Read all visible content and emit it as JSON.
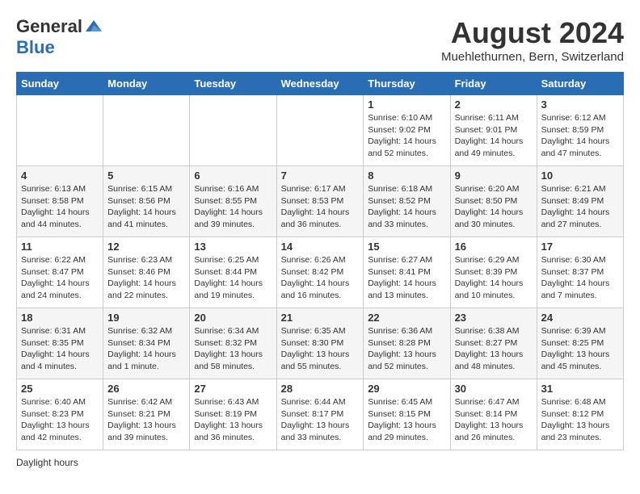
{
  "header": {
    "logo_general": "General",
    "logo_blue": "Blue",
    "month_title": "August 2024",
    "subtitle": "Muehlethurnen, Bern, Switzerland"
  },
  "days_of_week": [
    "Sunday",
    "Monday",
    "Tuesday",
    "Wednesday",
    "Thursday",
    "Friday",
    "Saturday"
  ],
  "weeks": [
    [
      {
        "day": "",
        "sunrise": "",
        "sunset": "",
        "daylight": ""
      },
      {
        "day": "",
        "sunrise": "",
        "sunset": "",
        "daylight": ""
      },
      {
        "day": "",
        "sunrise": "",
        "sunset": "",
        "daylight": ""
      },
      {
        "day": "",
        "sunrise": "",
        "sunset": "",
        "daylight": ""
      },
      {
        "day": "1",
        "sunrise": "6:10 AM",
        "sunset": "9:02 PM",
        "daylight": "14 hours and 52 minutes."
      },
      {
        "day": "2",
        "sunrise": "6:11 AM",
        "sunset": "9:01 PM",
        "daylight": "14 hours and 49 minutes."
      },
      {
        "day": "3",
        "sunrise": "6:12 AM",
        "sunset": "8:59 PM",
        "daylight": "14 hours and 47 minutes."
      }
    ],
    [
      {
        "day": "4",
        "sunrise": "6:13 AM",
        "sunset": "8:58 PM",
        "daylight": "14 hours and 44 minutes."
      },
      {
        "day": "5",
        "sunrise": "6:15 AM",
        "sunset": "8:56 PM",
        "daylight": "14 hours and 41 minutes."
      },
      {
        "day": "6",
        "sunrise": "6:16 AM",
        "sunset": "8:55 PM",
        "daylight": "14 hours and 39 minutes."
      },
      {
        "day": "7",
        "sunrise": "6:17 AM",
        "sunset": "8:53 PM",
        "daylight": "14 hours and 36 minutes."
      },
      {
        "day": "8",
        "sunrise": "6:18 AM",
        "sunset": "8:52 PM",
        "daylight": "14 hours and 33 minutes."
      },
      {
        "day": "9",
        "sunrise": "6:20 AM",
        "sunset": "8:50 PM",
        "daylight": "14 hours and 30 minutes."
      },
      {
        "day": "10",
        "sunrise": "6:21 AM",
        "sunset": "8:49 PM",
        "daylight": "14 hours and 27 minutes."
      }
    ],
    [
      {
        "day": "11",
        "sunrise": "6:22 AM",
        "sunset": "8:47 PM",
        "daylight": "14 hours and 24 minutes."
      },
      {
        "day": "12",
        "sunrise": "6:23 AM",
        "sunset": "8:46 PM",
        "daylight": "14 hours and 22 minutes."
      },
      {
        "day": "13",
        "sunrise": "6:25 AM",
        "sunset": "8:44 PM",
        "daylight": "14 hours and 19 minutes."
      },
      {
        "day": "14",
        "sunrise": "6:26 AM",
        "sunset": "8:42 PM",
        "daylight": "14 hours and 16 minutes."
      },
      {
        "day": "15",
        "sunrise": "6:27 AM",
        "sunset": "8:41 PM",
        "daylight": "14 hours and 13 minutes."
      },
      {
        "day": "16",
        "sunrise": "6:29 AM",
        "sunset": "8:39 PM",
        "daylight": "14 hours and 10 minutes."
      },
      {
        "day": "17",
        "sunrise": "6:30 AM",
        "sunset": "8:37 PM",
        "daylight": "14 hours and 7 minutes."
      }
    ],
    [
      {
        "day": "18",
        "sunrise": "6:31 AM",
        "sunset": "8:35 PM",
        "daylight": "14 hours and 4 minutes."
      },
      {
        "day": "19",
        "sunrise": "6:32 AM",
        "sunset": "8:34 PM",
        "daylight": "14 hours and 1 minute."
      },
      {
        "day": "20",
        "sunrise": "6:34 AM",
        "sunset": "8:32 PM",
        "daylight": "13 hours and 58 minutes."
      },
      {
        "day": "21",
        "sunrise": "6:35 AM",
        "sunset": "8:30 PM",
        "daylight": "13 hours and 55 minutes."
      },
      {
        "day": "22",
        "sunrise": "6:36 AM",
        "sunset": "8:28 PM",
        "daylight": "13 hours and 52 minutes."
      },
      {
        "day": "23",
        "sunrise": "6:38 AM",
        "sunset": "8:27 PM",
        "daylight": "13 hours and 48 minutes."
      },
      {
        "day": "24",
        "sunrise": "6:39 AM",
        "sunset": "8:25 PM",
        "daylight": "13 hours and 45 minutes."
      }
    ],
    [
      {
        "day": "25",
        "sunrise": "6:40 AM",
        "sunset": "8:23 PM",
        "daylight": "13 hours and 42 minutes."
      },
      {
        "day": "26",
        "sunrise": "6:42 AM",
        "sunset": "8:21 PM",
        "daylight": "13 hours and 39 minutes."
      },
      {
        "day": "27",
        "sunrise": "6:43 AM",
        "sunset": "8:19 PM",
        "daylight": "13 hours and 36 minutes."
      },
      {
        "day": "28",
        "sunrise": "6:44 AM",
        "sunset": "8:17 PM",
        "daylight": "13 hours and 33 minutes."
      },
      {
        "day": "29",
        "sunrise": "6:45 AM",
        "sunset": "8:15 PM",
        "daylight": "13 hours and 29 minutes."
      },
      {
        "day": "30",
        "sunrise": "6:47 AM",
        "sunset": "8:14 PM",
        "daylight": "13 hours and 26 minutes."
      },
      {
        "day": "31",
        "sunrise": "6:48 AM",
        "sunset": "8:12 PM",
        "daylight": "13 hours and 23 minutes."
      }
    ]
  ],
  "footer": {
    "note": "Daylight hours"
  }
}
